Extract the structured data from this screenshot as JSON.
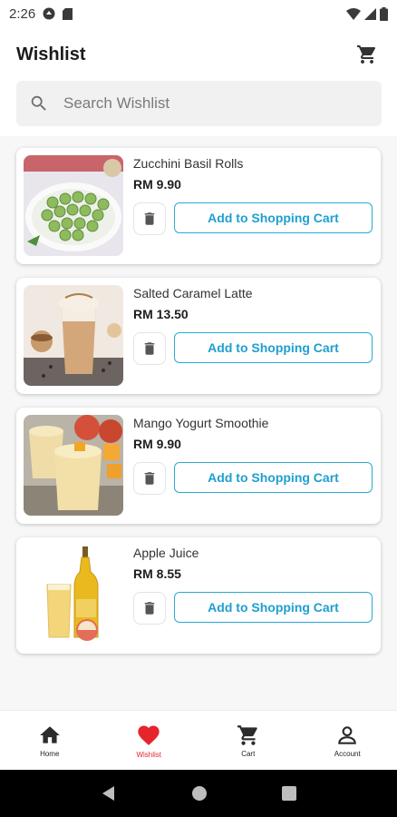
{
  "status": {
    "time": "2:26"
  },
  "header": {
    "title": "Wishlist"
  },
  "search": {
    "placeholder": "Search Wishlist"
  },
  "items": [
    {
      "name": "Zucchini Basil Rolls",
      "price": "RM 9.90",
      "add_label": "Add to Shopping Cart"
    },
    {
      "name": "Salted Caramel Latte",
      "price": "RM 13.50",
      "add_label": "Add to Shopping Cart"
    },
    {
      "name": "Mango Yogurt Smoothie",
      "price": "RM 9.90",
      "add_label": "Add to Shopping Cart"
    },
    {
      "name": "Apple Juice",
      "price": "RM 8.55",
      "add_label": "Add to Shopping Cart"
    }
  ],
  "nav": [
    {
      "label": "Home",
      "icon": "home-icon"
    },
    {
      "label": "Wishlist",
      "icon": "heart-icon",
      "active": true
    },
    {
      "label": "Cart",
      "icon": "cart-icon"
    },
    {
      "label": "Account",
      "icon": "account-icon"
    }
  ],
  "colors": {
    "accent": "#2aa9d6",
    "active_nav": "#e5252b"
  }
}
